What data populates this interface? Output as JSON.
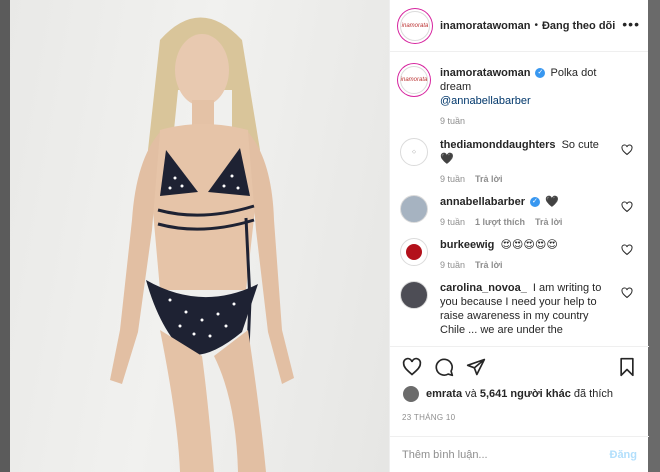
{
  "post": {
    "account": "inamoratawoman",
    "account_logo_text": "inamorata",
    "separator": "•",
    "follow_status": "Đang theo dõi",
    "more_icon": "ellipsis-icon"
  },
  "caption": {
    "user": "inamoratawoman",
    "text": "Polka dot dream",
    "mention": "@annabellabarber",
    "age": "9 tuần"
  },
  "comments": [
    {
      "user": "thediamonddaughters",
      "text": "So cute 🖤",
      "age": "9 tuần",
      "likes": "",
      "reply": "Trả lời",
      "verified": false
    },
    {
      "user": "annabellabarber",
      "text": "🖤",
      "age": "9 tuần",
      "likes": "1 lượt thích",
      "reply": "Trả lời",
      "verified": true
    },
    {
      "user": "burkeewig",
      "text": "😍😍😍😍😍",
      "age": "9 tuần",
      "likes": "",
      "reply": "Trả lời",
      "verified": false
    },
    {
      "user": "carolina_novoa_",
      "text": "I am writing to you because I need your help to raise awareness in my country Chile ... we are under the",
      "age": "",
      "likes": "",
      "reply": "",
      "verified": false
    }
  ],
  "likes": {
    "first_user": "emrata",
    "connector": "và",
    "others": "5,641 người khác",
    "suffix": "đã thích"
  },
  "date": "23 THÁNG 10",
  "comment_box": {
    "placeholder": "Thêm bình luận...",
    "post_label": "Đăng"
  },
  "colors": {
    "verified": "#3897f0",
    "post_disabled": "#b2dffc",
    "mention": "#00376b",
    "secondary_text": "#8e8e8e"
  }
}
